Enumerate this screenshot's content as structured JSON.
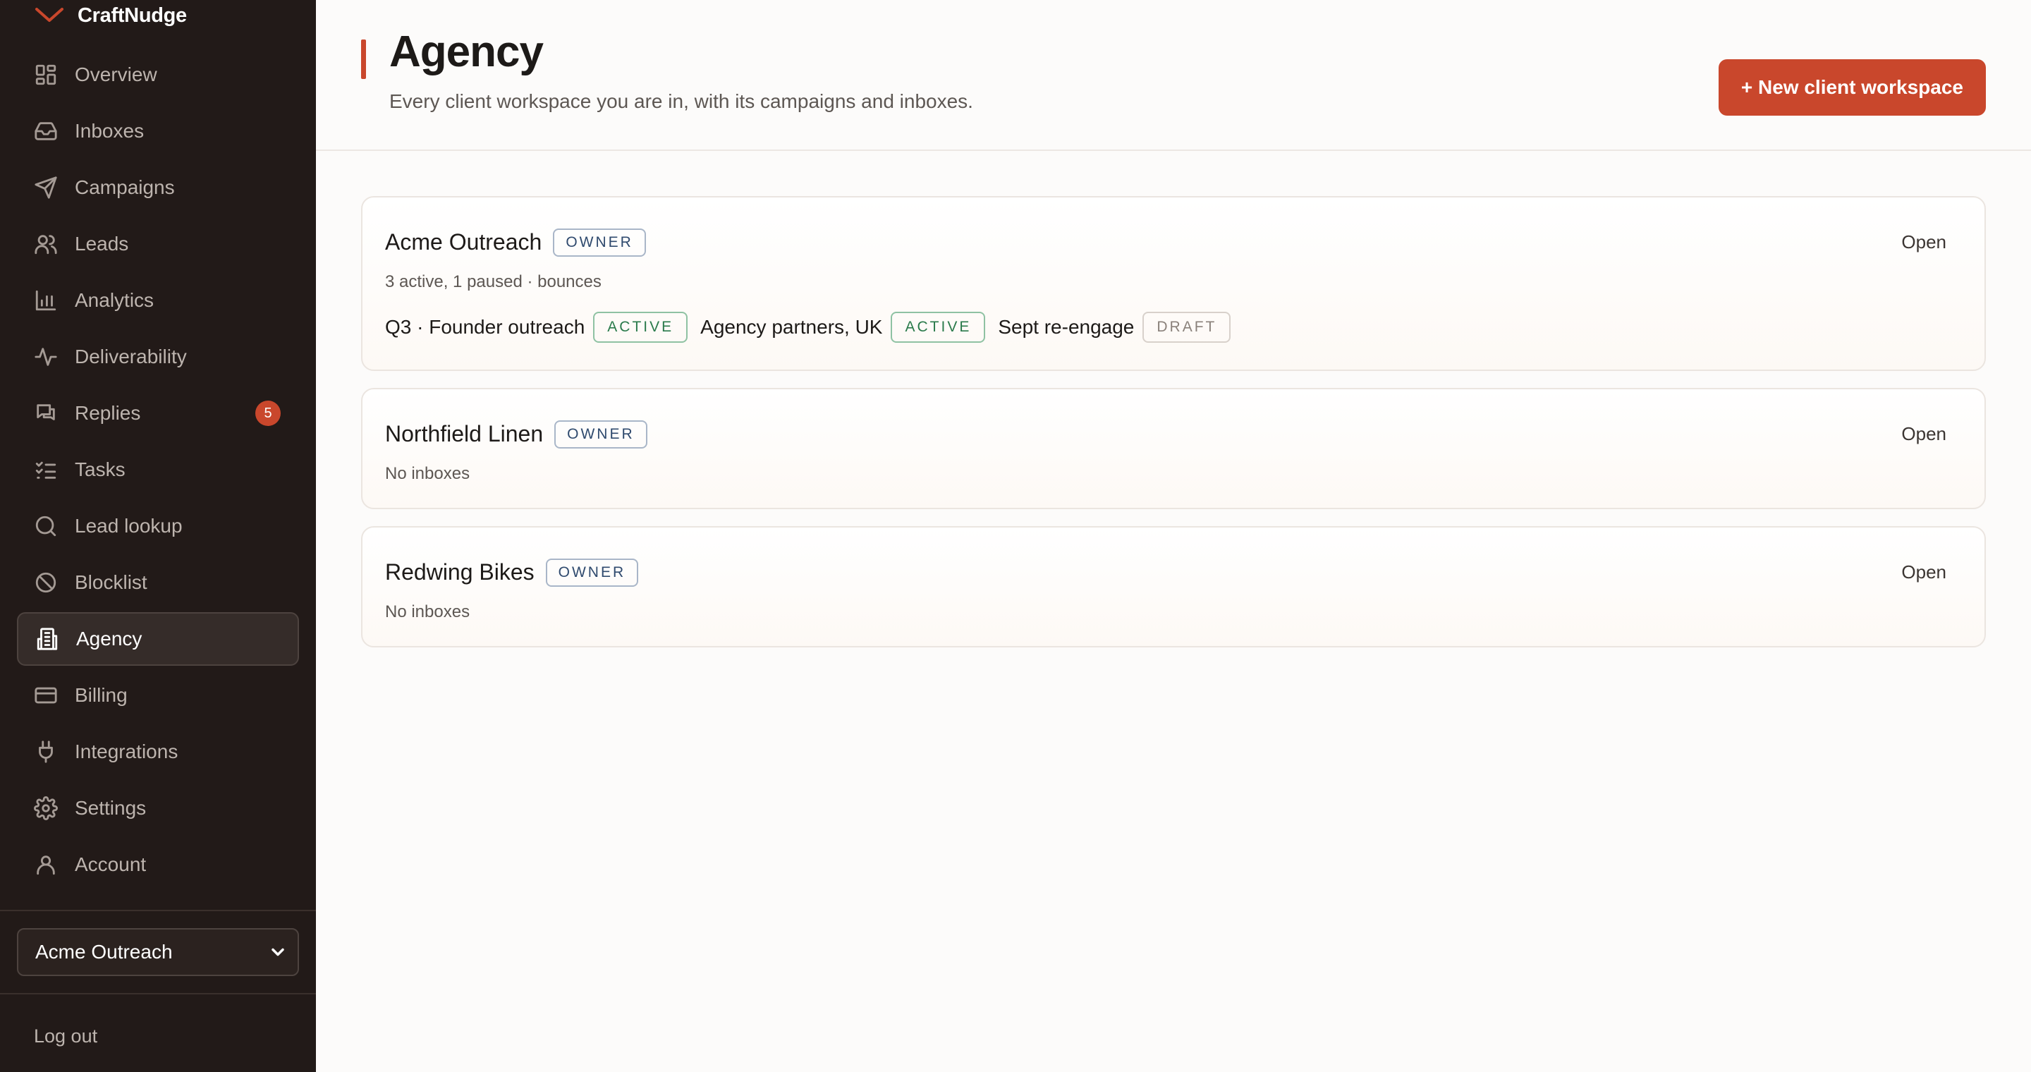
{
  "brand": {
    "name": "CraftNudge"
  },
  "sidebar": {
    "items": [
      {
        "label": "Overview",
        "icon": "grid-icon"
      },
      {
        "label": "Inboxes",
        "icon": "inbox-icon"
      },
      {
        "label": "Campaigns",
        "icon": "send-icon"
      },
      {
        "label": "Leads",
        "icon": "users-icon"
      },
      {
        "label": "Analytics",
        "icon": "bar-chart-icon"
      },
      {
        "label": "Deliverability",
        "icon": "activity-icon"
      },
      {
        "label": "Replies",
        "icon": "chat-icon",
        "badge": "5"
      },
      {
        "label": "Tasks",
        "icon": "checklist-icon"
      },
      {
        "label": "Lead lookup",
        "icon": "search-icon"
      },
      {
        "label": "Blocklist",
        "icon": "ban-icon"
      },
      {
        "label": "Agency",
        "icon": "building-icon",
        "active": true
      },
      {
        "label": "Billing",
        "icon": "credit-card-icon"
      },
      {
        "label": "Integrations",
        "icon": "plug-icon"
      },
      {
        "label": "Settings",
        "icon": "gear-icon"
      },
      {
        "label": "Account",
        "icon": "user-icon"
      }
    ],
    "workspace_select": "Acme Outreach",
    "logout_label": "Log out"
  },
  "header": {
    "title": "Agency",
    "subtitle": "Every client workspace you are in, with its campaigns and inboxes.",
    "new_button": "+ New client workspace"
  },
  "workspaces": [
    {
      "name": "Acme Outreach",
      "role": "OWNER",
      "meta": "3 active, 1 paused · bounces",
      "open": "Open",
      "campaigns": [
        {
          "name": "Q3 · Founder outreach",
          "status": "ACTIVE"
        },
        {
          "name": "Agency partners, UK",
          "status": "ACTIVE"
        },
        {
          "name": "Sept re-engage",
          "status": "DRAFT"
        }
      ]
    },
    {
      "name": "Northfield Linen",
      "role": "OWNER",
      "meta": "No inboxes",
      "open": "Open"
    },
    {
      "name": "Redwing Bikes",
      "role": "OWNER",
      "meta": "No inboxes",
      "open": "Open"
    }
  ],
  "colors": {
    "accent": "#c9472c",
    "sidebar_bg": "#221a18",
    "active_green": "#2a7a4b",
    "owner_blue": "#2f4a6e"
  }
}
